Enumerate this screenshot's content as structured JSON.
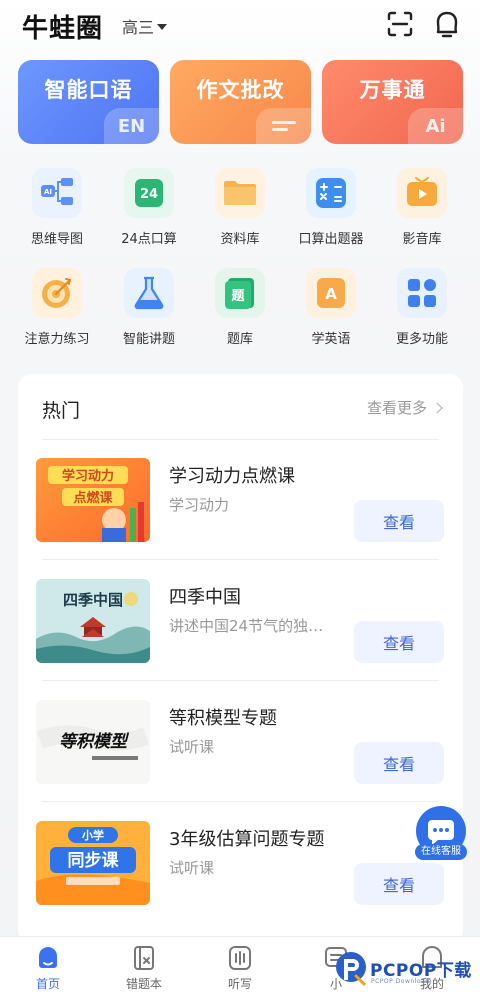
{
  "header": {
    "app_title": "牛蛙圈",
    "grade": "高三"
  },
  "banners": [
    {
      "label": "智能口语",
      "tab": "EN"
    },
    {
      "label": "作文批改",
      "tab": "="
    },
    {
      "label": "万事通",
      "tab": "Ai"
    }
  ],
  "tools": [
    {
      "label": "思维导图",
      "icon": "mindmap-icon"
    },
    {
      "label": "24点口算",
      "icon": "number-24-icon",
      "icon_text": "24"
    },
    {
      "label": "资料库",
      "icon": "folder-icon"
    },
    {
      "label": "口算出题器",
      "icon": "calculator-icon"
    },
    {
      "label": "影音库",
      "icon": "video-icon"
    },
    {
      "label": "注意力练习",
      "icon": "target-icon"
    },
    {
      "label": "智能讲题",
      "icon": "flask-icon"
    },
    {
      "label": "题库",
      "icon": "question-bank-icon",
      "icon_text": "题"
    },
    {
      "label": "学英语",
      "icon": "letter-a-icon",
      "icon_text": "A"
    },
    {
      "label": "更多功能",
      "icon": "grid-icon"
    }
  ],
  "hot": {
    "title": "热门",
    "see_more": "查看更多",
    "courses": [
      {
        "title": "学习动力点燃课",
        "subtitle": "学习动力",
        "button": "查看",
        "thumb_text": [
          "学习动力",
          "点燃课"
        ]
      },
      {
        "title": "四季中国",
        "subtitle": "讲述中国24节气的独…",
        "button": "查看",
        "thumb_text": [
          "四季中国"
        ]
      },
      {
        "title": "等积模型专题",
        "subtitle": "试听课",
        "button": "查看",
        "thumb_text": [
          "等积模型"
        ]
      },
      {
        "title": "3年级估算问题专题",
        "subtitle": "试听课",
        "button": "查看",
        "thumb_text": [
          "小学",
          "同步课"
        ]
      }
    ]
  },
  "float_service": {
    "label": "在线客服"
  },
  "nav": [
    {
      "label": "首页",
      "icon": "home-icon"
    },
    {
      "label": "错题本",
      "icon": "mistake-book-icon"
    },
    {
      "label": "听写",
      "icon": "dictation-icon"
    },
    {
      "label": "小",
      "icon": "class-icon"
    },
    {
      "label": "我的",
      "icon": "profile-icon"
    }
  ],
  "watermark": {
    "text": "PCPOP下载",
    "sub": "PCPOP Download"
  },
  "colors": {
    "accent": "#3c72f0",
    "banner_speaking": "#5a80f5",
    "banner_essay": "#f89456",
    "banner_wanshi": "#f3725a",
    "view_button_bg": "#eef3ff"
  }
}
